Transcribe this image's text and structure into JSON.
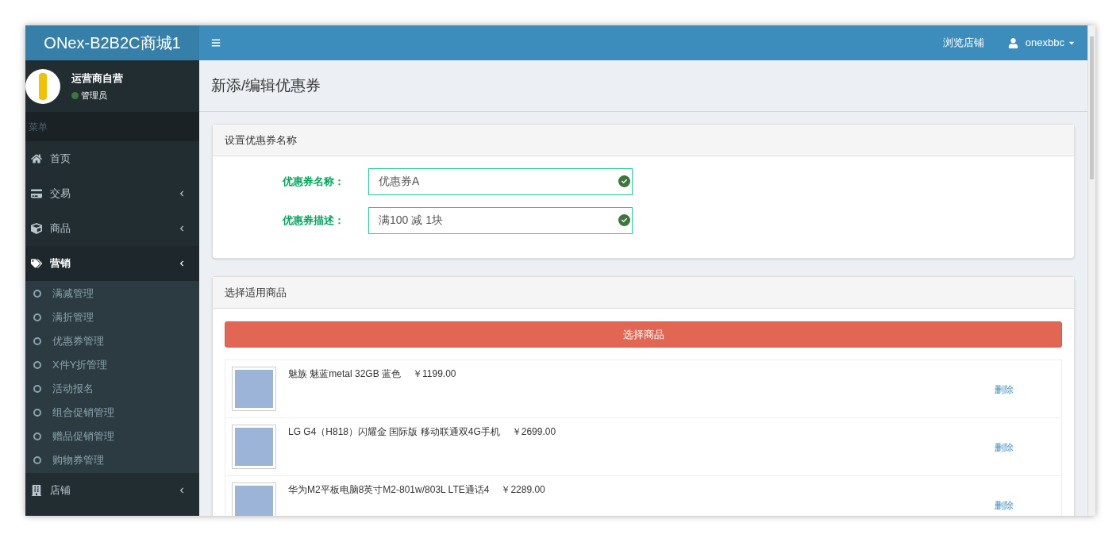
{
  "brand": "ONex-B2B2C商城1",
  "topbar": {
    "links": [
      "浏览店铺"
    ],
    "user": "onexbbc"
  },
  "user_panel": {
    "name": "运营商自营",
    "role": "管理员",
    "online": true
  },
  "menu_header": "菜单",
  "menu": [
    {
      "label": "首页",
      "kind": "link",
      "selected": false
    },
    {
      "label": "交易",
      "kind": "group",
      "selected": false
    },
    {
      "label": "商品",
      "kind": "group",
      "selected": false
    },
    {
      "label": "营销",
      "kind": "group",
      "selected": true,
      "children": [
        {
          "label": "满减管理"
        },
        {
          "label": "满折管理"
        },
        {
          "label": "优惠券管理"
        },
        {
          "label": "X件Y折管理"
        },
        {
          "label": "活动报名"
        },
        {
          "label": "组合促销管理"
        },
        {
          "label": "赠品促销管理"
        },
        {
          "label": "购物券管理"
        }
      ]
    },
    {
      "label": "店铺",
      "kind": "group",
      "selected": false
    }
  ],
  "page_title": "新添/编辑优惠券",
  "name_panel": {
    "title": "设置优惠券名称",
    "fields": [
      {
        "label": "优惠券名称：",
        "value": "优惠券A",
        "valid": true
      },
      {
        "label": "优惠券描述：",
        "value": "满100 减 1块",
        "valid": true
      }
    ]
  },
  "goods_panel": {
    "title": "选择适用商品",
    "button": "选择商品",
    "products": [
      {
        "name": "魅族 魅蓝metal 32GB 蓝色",
        "price": "￥1199.00",
        "action": "删除"
      },
      {
        "name": "LG G4（H818）闪耀金 国际版 移动联通双4G手机",
        "price": "￥2699.00",
        "action": "删除"
      },
      {
        "name": "华为M2平板电脑8英寸M2-801w/803L LTE通话4",
        "price": "￥2289.00",
        "action": "删除"
      }
    ]
  }
}
